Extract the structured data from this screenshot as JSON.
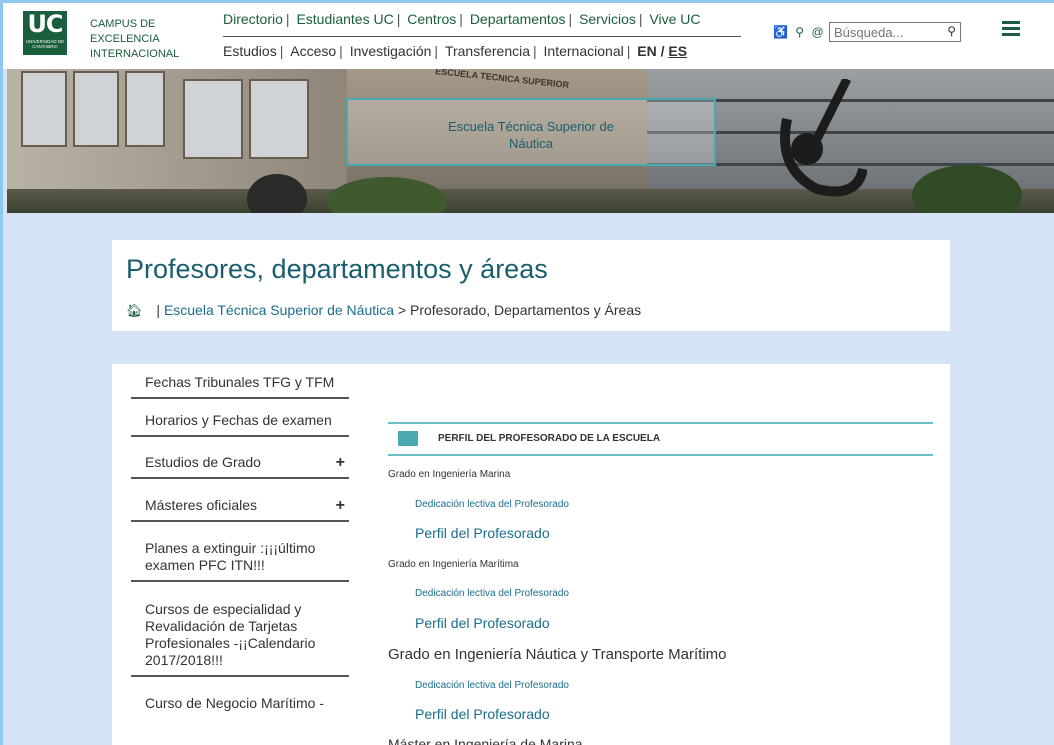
{
  "header": {
    "logo_text": "UC",
    "logo_sub": "UNIVERSIDAD DE CANTABRIA",
    "campus": [
      "CAMPUS DE",
      "EXCELENCIA",
      "INTERNACIONAL"
    ],
    "nav_top": [
      "Directorio",
      "Estudiantes UC",
      "Centros",
      "Departamentos",
      "Servicios",
      "Vive UC"
    ],
    "nav_bottom": [
      "Estudios",
      "Acceso",
      "Investigación",
      "Transferencia",
      "Internacional"
    ],
    "lang_en": "EN",
    "lang_sep": "/",
    "lang_es": "ES",
    "search_placeholder": "Búsqueda...",
    "icons": [
      "accessibility-icon",
      "location-icon",
      "at-icon",
      "search-icon",
      "menu-icon"
    ]
  },
  "banner": {
    "sign_text": "ESCUELA TECNICA SUPERIOR",
    "school_line1": "Escuela Técnica Superior de",
    "school_line2": "Náutica"
  },
  "title_panel": {
    "title": "Profesores, departamentos y áreas",
    "breadcrumb_sep": "|",
    "breadcrumb_link": "Escuela Técnica Superior de Náutica",
    "breadcrumb_current": "> Profesorado, Departamentos y Áreas"
  },
  "sidebar": {
    "items": [
      {
        "label": "Fechas Tribunales TFG y TFM"
      },
      {
        "label": "Horarios y Fechas de examen"
      },
      {
        "label": "Estudios de Grado",
        "expand": "+"
      },
      {
        "label": "Másteres oficiales",
        "expand": "+"
      },
      {
        "label": "Planes a extinguir :¡¡¡último examen PFC ITN!!!"
      },
      {
        "label": "Cursos de especialidad y Revalidación de Tarjetas Profesionales -¡¡Calendario 2017/2018!!!"
      },
      {
        "label": "Curso de Negocio Marítimo -"
      }
    ]
  },
  "main": {
    "section_header": "PERFIL DEL PROFESORADO DE LA ESCUELA",
    "degree_1": "Grado en Ingeniería Marina",
    "dedication_1": "Dedicación lectiva del Profesorado",
    "profile_1": "Perfil del Profesorado",
    "degree_2": "Grado en Ingeniería Marítima",
    "dedication_2": "Dedicación lectiva del Profesorado",
    "profile_2": "Perfil del Profesorado",
    "degree_3": "Grado en Ingeniería Náutica y Transporte Marítimo",
    "dedication_3": "Dedicación lectiva del Profesorado",
    "profile_3": "Perfil del Profesorado",
    "degree_4": "Máster en Ingeniería de Marina"
  }
}
